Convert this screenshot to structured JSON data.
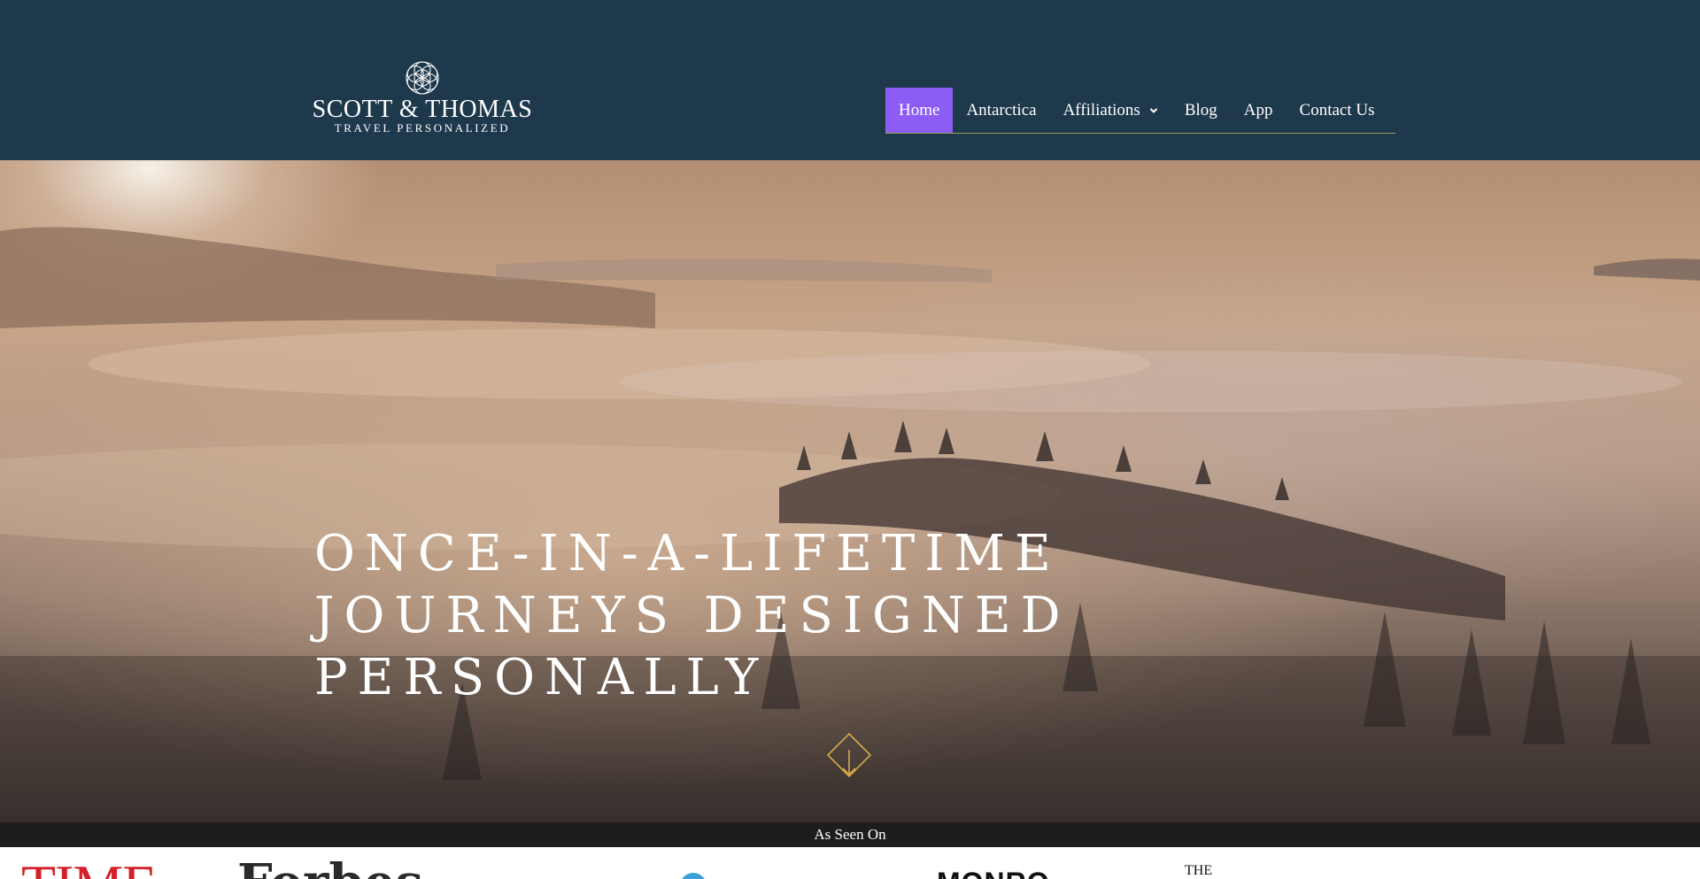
{
  "brand": {
    "name": "SCOTT & THOMAS",
    "tagline": "TRAVEL PERSONALIZED",
    "emblem_icon": "mandala-icon"
  },
  "nav": {
    "items": [
      {
        "label": "Home",
        "active": true
      },
      {
        "label": "Antarctica",
        "active": false
      },
      {
        "label": "Affiliations",
        "active": false,
        "dropdown": true
      },
      {
        "label": "Blog",
        "active": false
      },
      {
        "label": "App",
        "active": false
      },
      {
        "label": "Contact Us",
        "active": false
      }
    ],
    "dropdown_icon": "chevron-down-icon"
  },
  "hero": {
    "title_lines": [
      "ONCE-IN-A-LIFETIME",
      "JOURNEYS DESIGNED",
      "PERSONALLY"
    ],
    "scroll_icon": "diamond-arrow-down-icon"
  },
  "press": {
    "heading": "As Seen On",
    "logos": [
      "TIME",
      "Forbes",
      "MONRO",
      "THE"
    ]
  },
  "colors": {
    "header_bg": "#1e384c",
    "nav_active": "#8c5cf5",
    "accent_gold": "#d4a94a",
    "press_bar": "#1d1d1d",
    "time_red": "#d3202a"
  }
}
